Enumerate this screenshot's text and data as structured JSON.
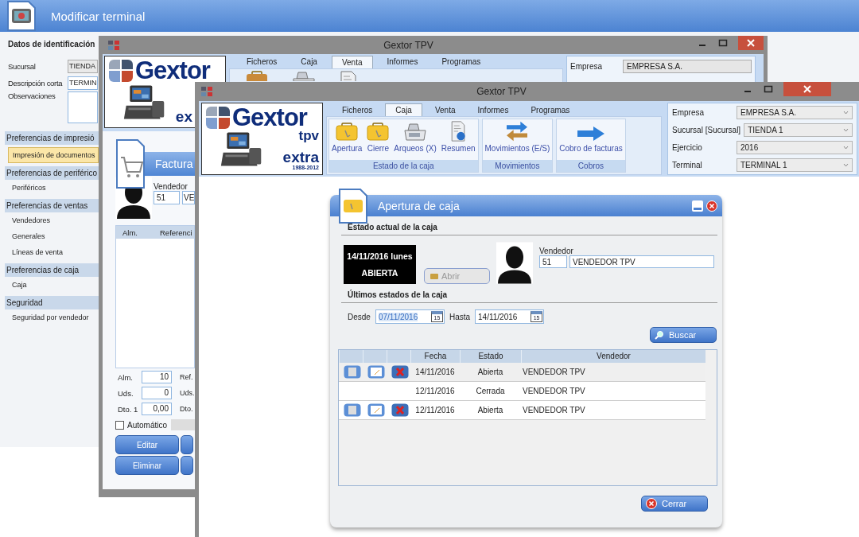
{
  "terminal_window": {
    "title": "Modificar terminal",
    "section": "Datos de identificación",
    "fields": [
      {
        "label": "Sucursal",
        "value": "TIENDA",
        "kind": "select"
      },
      {
        "label": "Descripción corta",
        "value": "TERMIN",
        "kind": "text"
      },
      {
        "label": "Observaciones",
        "kind": "textarea"
      }
    ],
    "nav": [
      {
        "heading": "Preferencias de impresió",
        "items": [
          {
            "label": "Impresión de documentos",
            "selected": true
          }
        ]
      },
      {
        "heading": "Preferencias de periférico",
        "items": [
          {
            "label": "Periféricos",
            "selected": false
          }
        ]
      },
      {
        "heading": "Preferencias de ventas",
        "items": [
          {
            "label": "Vendedores",
            "selected": false
          },
          {
            "label": "Generales",
            "selected": false
          },
          {
            "label": "Líneas de venta",
            "selected": false
          }
        ]
      },
      {
        "heading": "Preferencias de caja",
        "items": [
          {
            "label": "Caja",
            "selected": false
          }
        ]
      },
      {
        "heading": "Seguridad",
        "items": [
          {
            "label": "Seguridad por vendedor",
            "selected": false
          }
        ]
      }
    ]
  },
  "sales_window": {
    "title": "Gextor TPV",
    "logo": {
      "name": "Gextor",
      "edition": "ex"
    },
    "tabs": [
      {
        "label": "Ficheros",
        "selected": false
      },
      {
        "label": "Caja",
        "selected": false
      },
      {
        "label": "Venta",
        "selected": true
      },
      {
        "label": "Informes",
        "selected": false
      },
      {
        "label": "Programas",
        "selected": false
      }
    ],
    "context": [
      {
        "label": "Empresa",
        "value": "EMPRESA S.A."
      }
    ],
    "panel_title": "Factura",
    "seller": {
      "label": "Vendedor",
      "code": "51",
      "name": "VE"
    },
    "columns": [
      "Alm.",
      "Referenci"
    ],
    "fields": [
      {
        "label": "Alm.",
        "value": "10"
      },
      {
        "label": "Uds.",
        "value": "0"
      },
      {
        "label": "Dto. 1",
        "value": "0,00"
      }
    ],
    "second_labels": [
      "Ref.",
      "Uds.",
      "Dto."
    ],
    "automatic": {
      "label": "Automático",
      "checked": false
    },
    "buttons": [
      "Editar",
      "Eliminar"
    ]
  },
  "pos_window": {
    "title": "Gextor TPV",
    "logo": {
      "name": "Gextor",
      "product": "tpv",
      "edition": "extra",
      "years": "1988-2012"
    },
    "tabs": [
      {
        "label": "Ficheros",
        "selected": false
      },
      {
        "label": "Caja",
        "selected": true
      },
      {
        "label": "Venta",
        "selected": false
      },
      {
        "label": "Informes",
        "selected": false
      },
      {
        "label": "Programas",
        "selected": false
      }
    ],
    "groups": [
      {
        "label": "Estado de la caja",
        "buttons": [
          {
            "label": "Apertura",
            "kind": "case"
          },
          {
            "label": "Cierre",
            "kind": "case"
          },
          {
            "label": "Arqueos (X)",
            "kind": "register"
          },
          {
            "label": "Resumen",
            "kind": "report"
          }
        ]
      },
      {
        "label": "Movimientos",
        "buttons": [
          {
            "label": "Movimientos (E/S)",
            "kind": "exchange"
          }
        ]
      },
      {
        "label": "Cobros",
        "buttons": [
          {
            "label": "Cobro de facturas",
            "kind": "arrow"
          }
        ]
      }
    ],
    "context": [
      {
        "label": "Empresa",
        "value": "EMPRESA S.A."
      },
      {
        "label": "Sucursal [Sucursal]",
        "value": "TIENDA 1"
      },
      {
        "label": "Ejercicio",
        "value": "2016"
      },
      {
        "label": "Terminal",
        "value": "TERMINAL 1"
      }
    ]
  },
  "dialog": {
    "title": "Apertura de caja",
    "current_heading": "Estado actual de la caja",
    "status_date": "14/11/2016 lunes",
    "status": "ABIERTA",
    "open_button": {
      "label": "Abrir",
      "disabled": true
    },
    "seller": {
      "label": "Vendedor",
      "code": "51",
      "name": "VENDEDOR TPV"
    },
    "history_heading": "Últimos estados de la caja",
    "from": {
      "label": "Desde",
      "value": "07/11/2016",
      "calendar": "15"
    },
    "to": {
      "label": "Hasta",
      "value": "14/11/2016",
      "calendar": "15"
    },
    "search_button": "Buscar",
    "columns": [
      "Fecha",
      "Estado",
      "Vendedor"
    ],
    "rows": [
      {
        "fecha": "14/11/2016",
        "estado": "Abierta",
        "vendedor": "VENDEDOR TPV",
        "actions": true,
        "selected": true
      },
      {
        "fecha": "12/11/2016",
        "estado": "Cerrada",
        "vendedor": "VENDEDOR TPV",
        "actions": false,
        "selected": false
      },
      {
        "fecha": "12/11/2016",
        "estado": "Abierta",
        "vendedor": "VENDEDOR TPV",
        "actions": true,
        "selected": false
      }
    ],
    "close_button": "Cerrar"
  }
}
